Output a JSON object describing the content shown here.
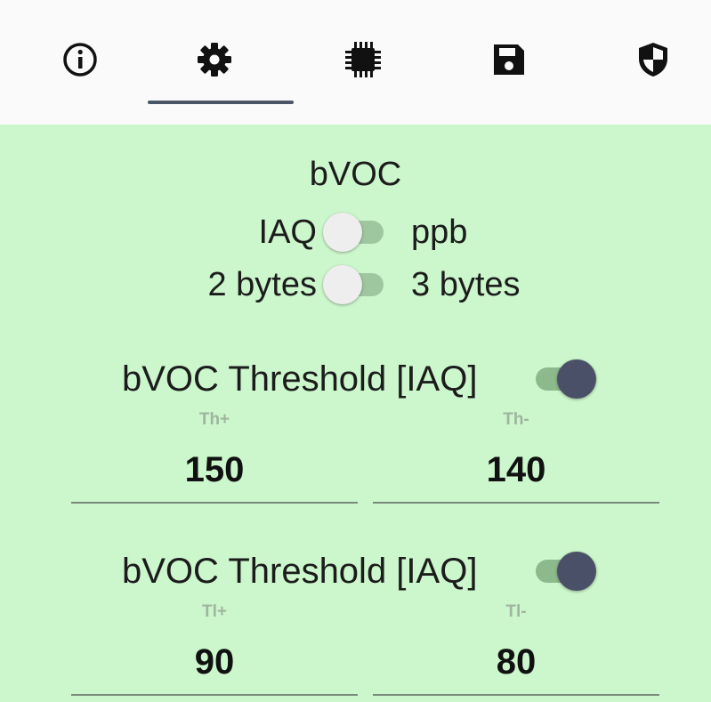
{
  "tabs": [
    {
      "name": "info",
      "icon": "info-icon"
    },
    {
      "name": "settings",
      "icon": "gear-icon",
      "selected": true
    },
    {
      "name": "chip",
      "icon": "chip-icon"
    },
    {
      "name": "save",
      "icon": "save-icon"
    },
    {
      "name": "security",
      "icon": "shield-icon"
    }
  ],
  "colors": {
    "panel_bg": "#ccf7cc",
    "indicator": "#4a5568",
    "switch_on_thumb": "#4a5068"
  },
  "section": {
    "title": "bVOC",
    "unit_toggle": {
      "left": "IAQ",
      "right": "ppb",
      "on": false
    },
    "size_toggle": {
      "left": "2 bytes",
      "right": "3 bytes",
      "on": false
    }
  },
  "threshold_high": {
    "title": "bVOC Threshold [IAQ]",
    "enabled": true,
    "fields": [
      {
        "hint": "Th+",
        "value": "150"
      },
      {
        "hint": "Th-",
        "value": "140"
      }
    ]
  },
  "threshold_low": {
    "title": "bVOC Threshold [IAQ]",
    "enabled": true,
    "fields": [
      {
        "hint": "Tl+",
        "value": "90"
      },
      {
        "hint": "Tl-",
        "value": "80"
      }
    ]
  }
}
